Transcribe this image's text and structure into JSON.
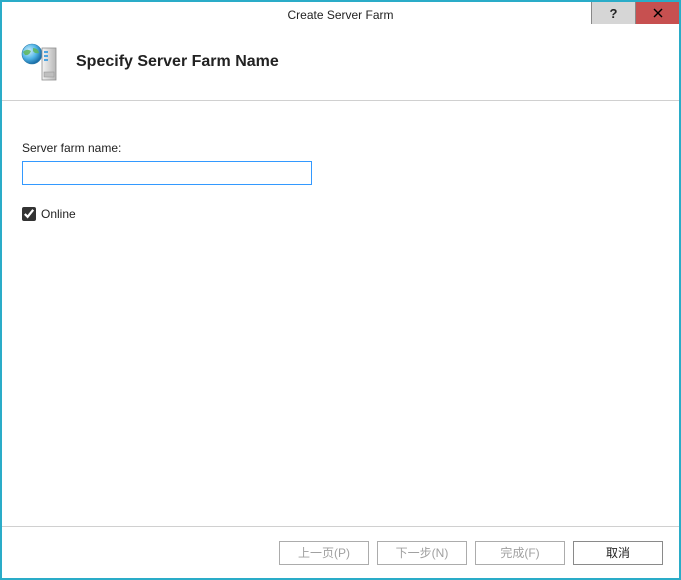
{
  "window": {
    "title": "Create Server Farm"
  },
  "header": {
    "title": "Specify Server Farm Name"
  },
  "form": {
    "farm_name_label": "Server farm name:",
    "farm_name_value": "",
    "online_label": "Online",
    "online_checked": true
  },
  "footer": {
    "prev": "上一页(P)",
    "next": "下一步(N)",
    "finish": "完成(F)",
    "cancel": "取消"
  }
}
